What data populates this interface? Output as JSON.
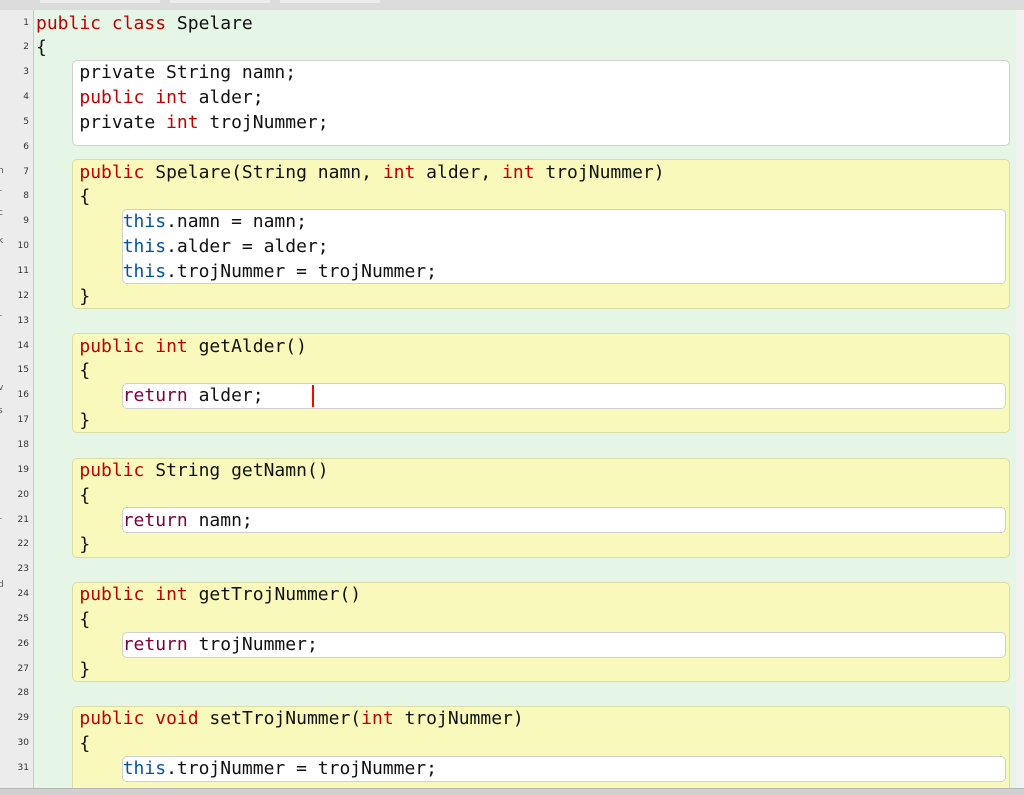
{
  "window": {
    "title": "",
    "sidepanel_glyphs": [
      "n",
      "r",
      "c",
      "k",
      "r",
      "I",
      "v",
      "s",
      "r",
      "d"
    ]
  },
  "editor": {
    "line_numbers": [
      "1",
      "2",
      "3",
      "4",
      "5",
      "6",
      "7",
      "8",
      "9",
      "10",
      "11",
      "12",
      "13",
      "14",
      "15",
      "16",
      "17",
      "18",
      "19",
      "20",
      "21",
      "22",
      "23",
      "24",
      "25",
      "26",
      "27",
      "28",
      "29",
      "30",
      "31"
    ],
    "lines": [
      [
        [
          "kw",
          "public"
        ],
        [
          "t",
          " "
        ],
        [
          "kw",
          "class"
        ],
        [
          "t",
          " Spelare"
        ]
      ],
      [
        [
          "t",
          "{"
        ]
      ],
      [
        [
          "t",
          "    private String namn;"
        ]
      ],
      [
        [
          "t",
          "    "
        ],
        [
          "kw",
          "public"
        ],
        [
          "t",
          " "
        ],
        [
          "kw",
          "int"
        ],
        [
          "t",
          " alder;"
        ]
      ],
      [
        [
          "t",
          "    private "
        ],
        [
          "kw",
          "int"
        ],
        [
          "t",
          " trojNummer;"
        ]
      ],
      [],
      [
        [
          "t",
          "    "
        ],
        [
          "kw",
          "public"
        ],
        [
          "t",
          " Spelare(String namn, "
        ],
        [
          "kw",
          "int"
        ],
        [
          "t",
          " alder, "
        ],
        [
          "kw",
          "int"
        ],
        [
          "t",
          " trojNummer)"
        ]
      ],
      [
        [
          "t",
          "    {"
        ]
      ],
      [
        [
          "t",
          "        "
        ],
        [
          "th",
          "this"
        ],
        [
          "t",
          ".namn = namn;"
        ]
      ],
      [
        [
          "t",
          "        "
        ],
        [
          "th",
          "this"
        ],
        [
          "t",
          ".alder = alder;"
        ]
      ],
      [
        [
          "t",
          "        "
        ],
        [
          "th",
          "this"
        ],
        [
          "t",
          ".trojNummer = trojNummer;"
        ]
      ],
      [
        [
          "t",
          "    }"
        ]
      ],
      [],
      [
        [
          "t",
          "    "
        ],
        [
          "kw",
          "public"
        ],
        [
          "t",
          " "
        ],
        [
          "kw",
          "int"
        ],
        [
          "t",
          " getAlder()"
        ]
      ],
      [
        [
          "t",
          "    {"
        ]
      ],
      [
        [
          "t",
          "        "
        ],
        [
          "ret",
          "return"
        ],
        [
          "t",
          " alder;"
        ]
      ],
      [
        [
          "t",
          "    }"
        ]
      ],
      [],
      [
        [
          "t",
          "    "
        ],
        [
          "kw",
          "public"
        ],
        [
          "t",
          " String getNamn()"
        ]
      ],
      [
        [
          "t",
          "    {"
        ]
      ],
      [
        [
          "t",
          "        "
        ],
        [
          "ret",
          "return"
        ],
        [
          "t",
          " namn;"
        ]
      ],
      [
        [
          "t",
          "    }"
        ]
      ],
      [],
      [
        [
          "t",
          "    "
        ],
        [
          "kw",
          "public"
        ],
        [
          "t",
          " "
        ],
        [
          "kw",
          "int"
        ],
        [
          "t",
          " getTrojNummer()"
        ]
      ],
      [
        [
          "t",
          "    {"
        ]
      ],
      [
        [
          "t",
          "        "
        ],
        [
          "ret",
          "return"
        ],
        [
          "t",
          " trojNummer;"
        ]
      ],
      [
        [
          "t",
          "    }"
        ]
      ],
      [],
      [
        [
          "t",
          "    "
        ],
        [
          "kw",
          "public"
        ],
        [
          "t",
          " "
        ],
        [
          "kw",
          "void"
        ],
        [
          "t",
          " setTrojNummer("
        ],
        [
          "kw",
          "int"
        ],
        [
          "t",
          " trojNummer)"
        ]
      ],
      [
        [
          "t",
          "    {"
        ]
      ],
      [
        [
          "t",
          "        "
        ],
        [
          "th",
          "this"
        ],
        [
          "t",
          ".trojNummer = trojNummer;"
        ]
      ]
    ],
    "cursor_line": 16,
    "colors": {
      "class_scope": "#e6f6e6",
      "method_scope": "#f9f9bc",
      "body_scope": "#ffffff",
      "keyword": "#c00000",
      "this_keyword": "#00549c",
      "return_keyword": "#7a0040",
      "cursor": "#ff0000"
    }
  }
}
